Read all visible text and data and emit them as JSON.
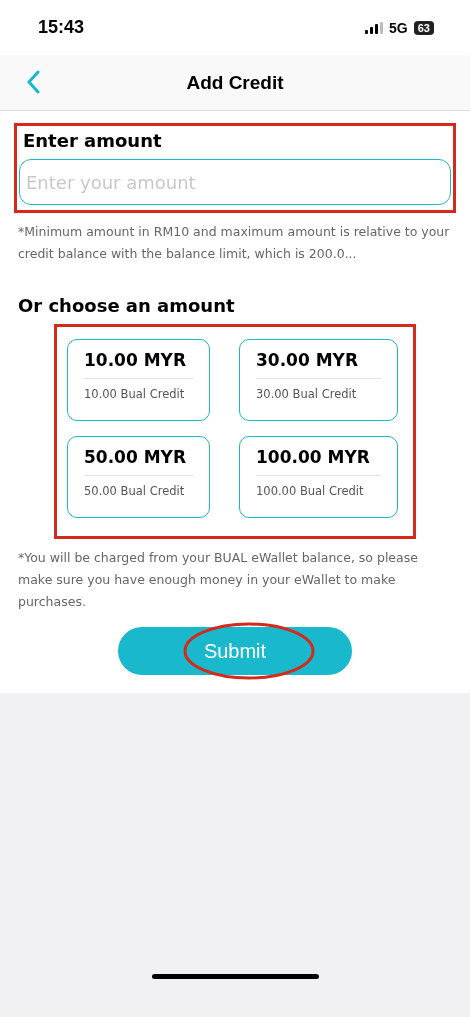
{
  "status_bar": {
    "time": "15:43",
    "network": "5G",
    "battery": "63"
  },
  "header": {
    "title": "Add Credit"
  },
  "amount": {
    "label": "Enter amount",
    "placeholder": "Enter your amount",
    "note": "*Minimum amount in RM10 and maximum amount is relative to your credit balance with the balance limit, which is 200.0..."
  },
  "choices": {
    "title": "Or choose an amount",
    "options": [
      {
        "amount": "10.00 MYR",
        "credit": "10.00 Bual Credit",
        "selected": false
      },
      {
        "amount": "30.00 MYR",
        "credit": "30.00 Bual Credit",
        "selected": false
      },
      {
        "amount": "50.00 MYR",
        "credit": "50.00 Bual Credit",
        "selected": false
      },
      {
        "amount": "100.00 MYR",
        "credit": "100.00 Bual Credit",
        "selected": false
      }
    ]
  },
  "footnote": "*You will be charged from your BUAL eWallet balance, so please make sure you have enough money in your eWallet to make purchases.",
  "submit": {
    "label": "Submit"
  }
}
